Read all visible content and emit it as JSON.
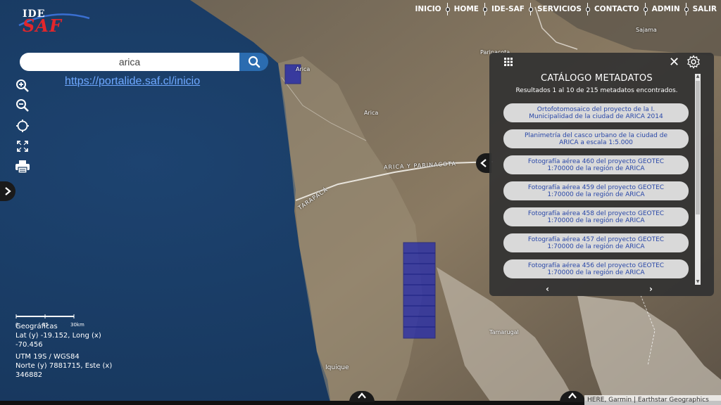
{
  "logo": {
    "top_text": "IDE",
    "main_text": "SAF"
  },
  "nav": {
    "items": [
      "INICIO",
      "HOME",
      "IDE-SAF",
      "SERVICIOS",
      "CONTACTO",
      "ADMIN",
      "SALIR"
    ]
  },
  "search": {
    "value": "arica",
    "button_icon": "search-icon"
  },
  "url_overlay": "https://portalide.saf.cl/inicio",
  "tools": [
    {
      "name": "zoom-in-icon"
    },
    {
      "name": "zoom-out-icon"
    },
    {
      "name": "locate-icon"
    },
    {
      "name": "fullscreen-icon"
    },
    {
      "name": "print-icon"
    }
  ],
  "scale": {
    "ticks": [
      "0",
      "15",
      "30km"
    ]
  },
  "coordinates": {
    "geo_title": "Geográficas",
    "geo_line1": "Lat (y) -19.152, Long (x)",
    "geo_line2": "-70.456",
    "utm_title": "UTM 19S / WGS84",
    "utm_line1": "Norte (y) 7881715, Este (x)",
    "utm_line2": "346882"
  },
  "map_labels": {
    "arica": "Arica",
    "arica2": "Arica",
    "region": "ARICA Y PARINACOTA",
    "tarapaca": "TARAPACÁ",
    "iquique": "Iquique",
    "tamarugal": "Tamarugal",
    "sajama": "Sajama",
    "pallasca": "Parinacota"
  },
  "catalog": {
    "title": "CATÁLOGO METADATOS",
    "results": "Resultados 1 al 10 de 215 metadatos encontrados.",
    "items": [
      {
        "line1": "Ortofotomosaico del proyecto de la I.",
        "line2": "Municipalidad de la ciudad de ARICA 2014"
      },
      {
        "line1": "Planimetría del casco urbano de la ciudad de",
        "line2": "ARICA a escala 1:5.000"
      },
      {
        "line1": "Fotografía aérea 460 del proyecto GEOTEC",
        "line2": "1:70000 de la región de ARICA"
      },
      {
        "line1": "Fotografía aérea 459 del proyecto GEOTEC",
        "line2": "1:70000 de la región de ARICA"
      },
      {
        "line1": "Fotografía aérea 458 del proyecto GEOTEC",
        "line2": "1:70000 de la región de ARICA"
      },
      {
        "line1": "Fotografía aérea 457 del proyecto GEOTEC",
        "line2": "1:70000 de la región de ARICA"
      },
      {
        "line1": "Fotografía aérea 456 del proyecto GEOTEC",
        "line2": "1:70000 de la región de ARICA"
      }
    ],
    "prev": "‹",
    "next": "›",
    "close": "✕"
  },
  "attribution": "HERE, Garmin | Earthstar Geographics",
  "colors": {
    "ocean": "#1b3d63",
    "accent": "#2b6cb0",
    "footprint": "#2a2fa8",
    "logo_red": "#e2262b"
  }
}
